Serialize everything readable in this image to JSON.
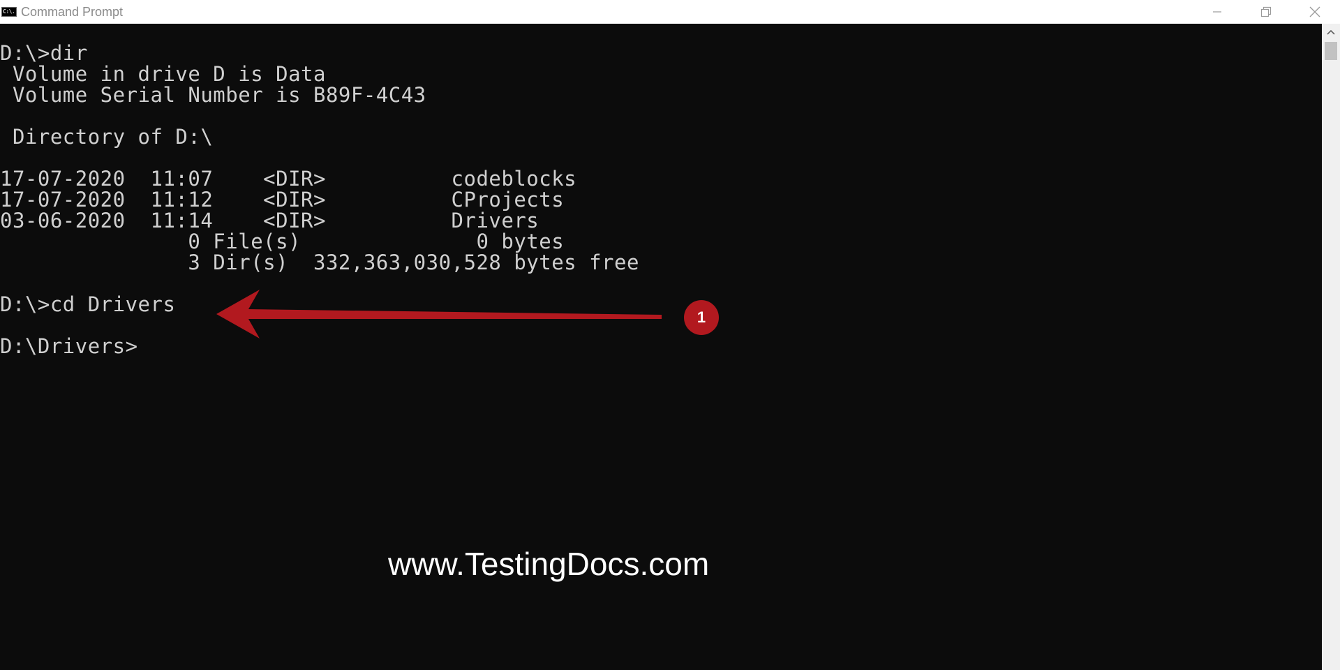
{
  "window": {
    "icon_label": "C:\\.",
    "title": "Command Prompt",
    "controls": [
      "minimize-icon",
      "restore-icon",
      "close-icon"
    ]
  },
  "console": {
    "lines": [
      "D:\\>dir",
      " Volume in drive D is Data",
      " Volume Serial Number is B89F-4C43",
      "",
      " Directory of D:\\",
      "",
      "17-07-2020  11:07    <DIR>          codeblocks",
      "17-07-2020  11:12    <DIR>          CProjects",
      "03-06-2020  11:14    <DIR>          Drivers",
      "               0 File(s)              0 bytes",
      "               3 Dir(s)  332,363,030,528 bytes free",
      "",
      "D:\\>cd Drivers",
      "",
      "D:\\Drivers>"
    ]
  },
  "annotation": {
    "badge_number": "1",
    "arrow_icon": "left-arrow-icon",
    "color": "#b2191f"
  },
  "watermark": "www.TestingDocs.com",
  "colors": {
    "console_background": "#0c0c0c",
    "console_text": "#d0d0d0",
    "titlebar": "#ffffff"
  }
}
